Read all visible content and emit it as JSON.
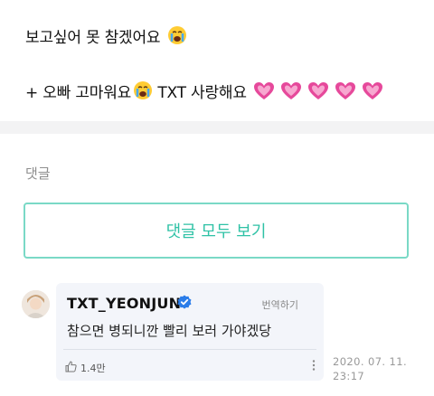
{
  "post": {
    "line1": "보고싶어 못 참겠어요",
    "line1_emoji": "loudly-crying-face-emoji",
    "line2_prefix": "+ 오빠 고마워요",
    "line2_emoji": "loudly-crying-face-emoji",
    "line2_suffix": "TXT 사랑해요",
    "hearts_icon": "growing-pink-heart-emoji",
    "heart_count": 5
  },
  "comments": {
    "section_label": "댓글",
    "view_all_label": "댓글 모두 보기"
  },
  "reply": {
    "author": "TXT_YEONJUN",
    "verified_icon": "verified-badge-icon",
    "translate_label": "번역하기",
    "text": "참으면 병되니깐 빨리 보러 가야겠당",
    "like_icon": "thumbs-up-icon",
    "like_count": "1.4만",
    "more_icon": "more-vertical-icon",
    "timestamp_line1": "2020. 07. 11.",
    "timestamp_line2": "23:17"
  },
  "colors": {
    "accent": "#2fc2a6",
    "accent_border": "#7ad9c6",
    "bubble_bg": "#f3f5fa",
    "verified_blue": "#2b7de9",
    "heart_pink": "#e6499b"
  }
}
